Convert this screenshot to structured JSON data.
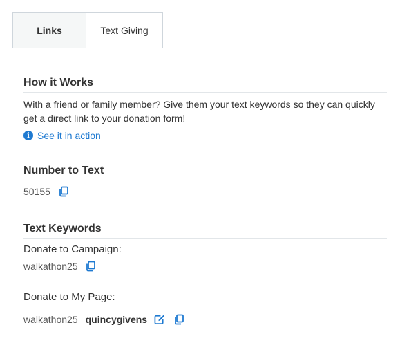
{
  "tabs": [
    {
      "label": "Links",
      "active": false
    },
    {
      "label": "Text Giving",
      "active": true
    }
  ],
  "how_it_works": {
    "title": "How it Works",
    "description": "With a friend or family member? Give them your text keywords so they can quickly get a direct link to your donation form!",
    "link_label": "See it in action",
    "link_icon": "info-icon"
  },
  "number_to_text": {
    "title": "Number to Text",
    "number": "50155",
    "copy_icon": "copy-icon"
  },
  "text_keywords": {
    "title": "Text Keywords",
    "campaign_label": "Donate to Campaign:",
    "campaign_keyword": "walkathon25",
    "my_page_label": "Donate to My Page:",
    "my_page_keyword_prefix": "walkathon25",
    "my_page_keyword_suffix": "quincygivens",
    "edit_icon": "edit-icon",
    "copy_icon": "copy-icon"
  },
  "colors": {
    "accent": "#1f7ad1",
    "border": "#cfd6dc",
    "inactive_tab_bg": "#f5f7f7"
  }
}
